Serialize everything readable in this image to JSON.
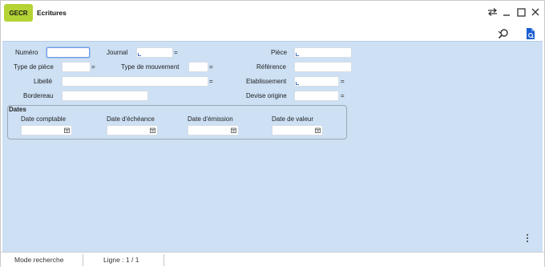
{
  "window": {
    "app_code": "GECR",
    "title": "Ecritures",
    "controls": [
      "swap-icon",
      "minimize-icon",
      "maximize-icon",
      "close-icon"
    ]
  },
  "toolbar": {
    "icons": [
      "search-icon",
      "document-search-icon"
    ]
  },
  "form": {
    "numero_label": "Numéro",
    "journal_label": "Journal",
    "piece_label": "Pièce",
    "type_piece_label": "Type de pièce",
    "type_mouvement_label": "Type de mouvement",
    "reference_label": "Référence",
    "libelle_label": "Libellé",
    "etablissement_label": "Etablissement",
    "bordereau_label": "Bordereau",
    "devise_label": "Devise origine",
    "lookup_glyph": "="
  },
  "dates": {
    "title": "Dates",
    "comptable_label": "Date comptable",
    "echeance_label": "Date d'échéance",
    "emission_label": "Date d'émission",
    "valeur_label": "Date de valeur"
  },
  "status": {
    "mode": "Mode recherche",
    "ligne": "Ligne : 1 / 1"
  },
  "colors": {
    "badge": "#b4d335",
    "panel": "#cde0f4",
    "accent": "#1a5fd1"
  }
}
